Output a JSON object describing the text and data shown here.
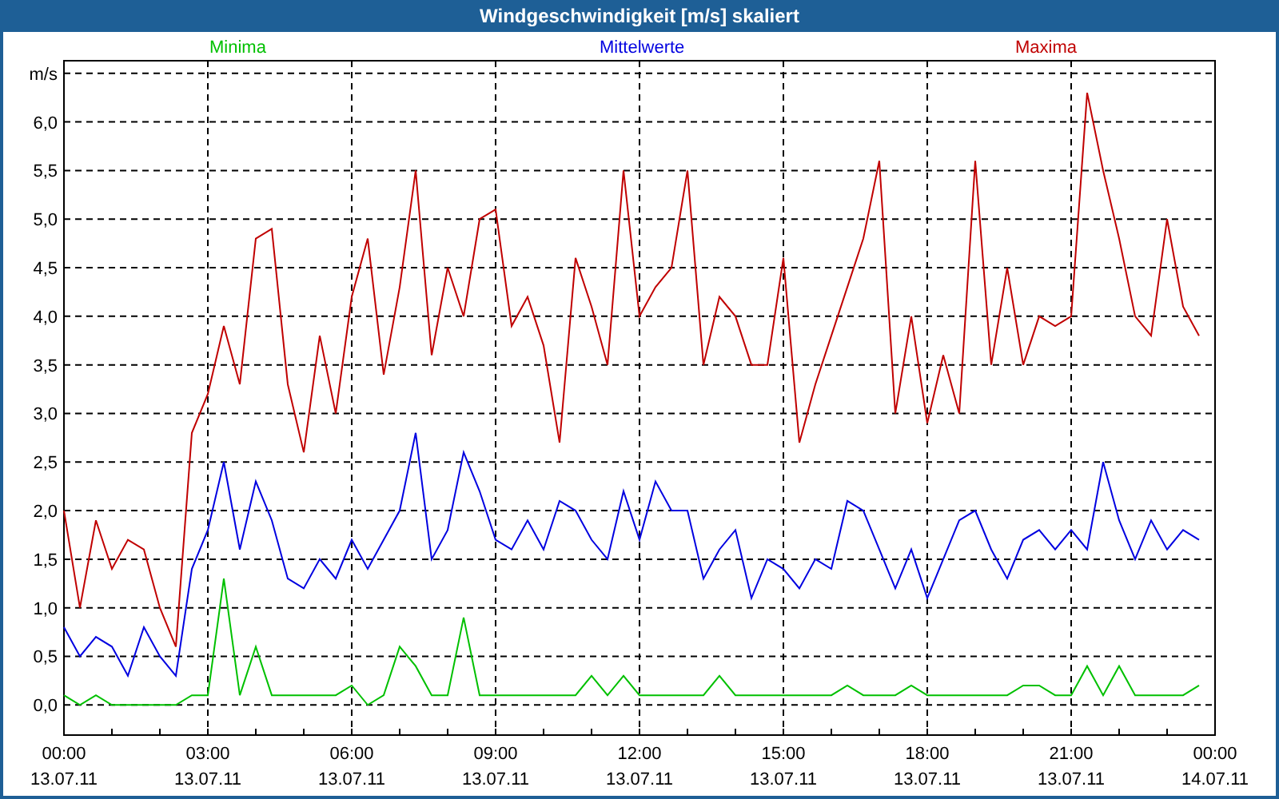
{
  "window": {
    "title": "Windgeschwindigkeit [m/s] skaliert"
  },
  "chart": {
    "chart_data": {
      "type": "line",
      "ylabel": "m/s",
      "categories": [
        "00:00 13.07.11",
        null,
        null,
        null,
        null,
        null,
        null,
        null,
        null,
        "03:00 13.07.11",
        null,
        null,
        null,
        null,
        null,
        null,
        null,
        null,
        "06:00 13.07.11",
        null,
        null,
        null,
        null,
        null,
        null,
        null,
        null,
        "09:00 13.07.11",
        null,
        null,
        null,
        null,
        null,
        null,
        null,
        null,
        "12:00 13.07.11",
        null,
        null,
        null,
        null,
        null,
        null,
        null,
        null,
        "15:00 13.07.11",
        null,
        null,
        null,
        null,
        null,
        null,
        null,
        null,
        "18:00 13.07.11",
        null,
        null,
        null,
        null,
        null,
        null,
        null,
        null,
        "21:00 13.07.11",
        null,
        null,
        null,
        null,
        null,
        null,
        null,
        null,
        "00:00 14.07.11"
      ],
      "series": [
        {
          "name": "Minima",
          "color": "#00c000",
          "values": [
            0.1,
            0,
            0.1,
            0,
            0,
            0,
            0,
            0,
            0.1,
            0.1,
            1.3,
            0.1,
            0.6,
            0.1,
            0.1,
            0.1,
            0.1,
            0.1,
            0.2,
            0,
            0.1,
            0.6,
            0.4,
            0.1,
            0.1,
            0.9,
            0.1,
            0.1,
            0.1,
            0.1,
            0.1,
            0.1,
            0.1,
            0.3,
            0.1,
            0.3,
            0.1,
            0.1,
            0.1,
            0.1,
            0.1,
            0.3,
            0.1,
            0.1,
            0.1,
            0.1,
            0.1,
            0.1,
            0.1,
            0.2,
            0.1,
            0.1,
            0.1,
            0.2,
            0.1,
            0.1,
            0.1,
            0.1,
            0.1,
            0.1,
            0.2,
            0.2,
            0.1,
            0.1,
            0.4,
            0.1,
            0.4,
            0.1,
            0.1,
            0.1,
            0.1,
            0.2,
            null
          ]
        },
        {
          "name": "Mittelwerte",
          "color": "#0000e0",
          "values": [
            0.8,
            0.5,
            0.7,
            0.6,
            0.3,
            0.8,
            0.5,
            0.3,
            1.4,
            1.8,
            2.5,
            1.6,
            2.3,
            1.9,
            1.3,
            1.2,
            1.5,
            1.3,
            1.7,
            1.4,
            1.7,
            2.0,
            2.8,
            1.5,
            1.8,
            2.6,
            2.2,
            1.7,
            1.6,
            1.9,
            1.6,
            2.1,
            2.0,
            1.7,
            1.5,
            2.2,
            1.7,
            2.3,
            2.0,
            2.0,
            1.3,
            1.6,
            1.8,
            1.1,
            1.5,
            1.4,
            1.2,
            1.5,
            1.4,
            2.1,
            2.0,
            1.6,
            1.2,
            1.6,
            1.1,
            1.5,
            1.9,
            2.0,
            1.6,
            1.3,
            1.7,
            1.8,
            1.6,
            1.8,
            1.6,
            2.5,
            1.9,
            1.5,
            1.9,
            1.6,
            1.8,
            1.7,
            null
          ]
        },
        {
          "name": "Maxima",
          "color": "#c00000",
          "values": [
            2.0,
            1.0,
            1.9,
            1.4,
            1.7,
            1.6,
            1.0,
            0.6,
            2.8,
            3.2,
            3.9,
            3.3,
            4.8,
            4.9,
            3.3,
            2.6,
            3.8,
            3.0,
            4.2,
            4.8,
            3.4,
            4.3,
            5.5,
            3.6,
            4.5,
            4.0,
            5.0,
            5.1,
            3.9,
            4.2,
            3.7,
            2.7,
            4.6,
            4.1,
            3.5,
            5.5,
            4.0,
            4.3,
            4.5,
            5.5,
            3.5,
            4.2,
            4.0,
            3.5,
            3.5,
            4.6,
            2.7,
            3.3,
            3.8,
            4.3,
            4.8,
            5.6,
            3.0,
            4.0,
            2.9,
            3.6,
            3.0,
            5.6,
            3.5,
            4.5,
            3.5,
            4.0,
            3.9,
            4.0,
            6.3,
            5.5,
            4.8,
            4.0,
            3.8,
            5.0,
            4.1,
            3.8,
            null
          ]
        }
      ],
      "grid": true,
      "ylim": [
        -0.31,
        6.63
      ],
      "yticks": [
        {
          "value": 0,
          "label": "0,0"
        },
        {
          "value": 0.5,
          "label": "0,5"
        },
        {
          "value": 1,
          "label": "1,0"
        },
        {
          "value": 1.5,
          "label": "1,5"
        },
        {
          "value": 2,
          "label": "2,0"
        },
        {
          "value": 2.5,
          "label": "2,5"
        },
        {
          "value": 3,
          "label": "3,0"
        },
        {
          "value": 3.5,
          "label": "3,5"
        },
        {
          "value": 4,
          "label": "4,0"
        },
        {
          "value": 4.5,
          "label": "4,5"
        },
        {
          "value": 5,
          "label": "5,0"
        },
        {
          "value": 5.5,
          "label": "5,5"
        },
        {
          "value": 6,
          "label": "6,0"
        }
      ]
    }
  }
}
